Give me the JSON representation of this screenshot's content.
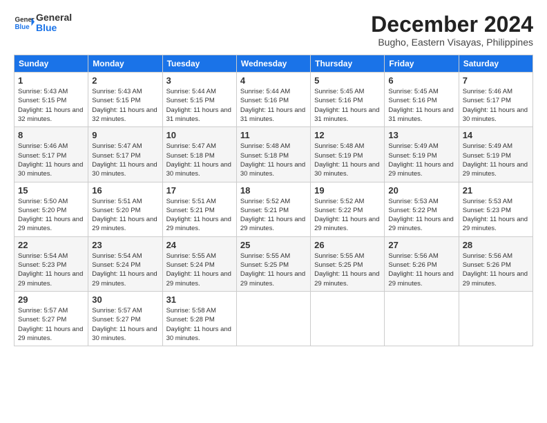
{
  "logo": {
    "line1": "General",
    "line2": "Blue"
  },
  "title": "December 2024",
  "location": "Bugho, Eastern Visayas, Philippines",
  "weekdays": [
    "Sunday",
    "Monday",
    "Tuesday",
    "Wednesday",
    "Thursday",
    "Friday",
    "Saturday"
  ],
  "weeks": [
    [
      {
        "day": "1",
        "sunrise": "5:43 AM",
        "sunset": "5:15 PM",
        "daylight": "11 hours and 32 minutes."
      },
      {
        "day": "2",
        "sunrise": "5:43 AM",
        "sunset": "5:15 PM",
        "daylight": "11 hours and 32 minutes."
      },
      {
        "day": "3",
        "sunrise": "5:44 AM",
        "sunset": "5:15 PM",
        "daylight": "11 hours and 31 minutes."
      },
      {
        "day": "4",
        "sunrise": "5:44 AM",
        "sunset": "5:16 PM",
        "daylight": "11 hours and 31 minutes."
      },
      {
        "day": "5",
        "sunrise": "5:45 AM",
        "sunset": "5:16 PM",
        "daylight": "11 hours and 31 minutes."
      },
      {
        "day": "6",
        "sunrise": "5:45 AM",
        "sunset": "5:16 PM",
        "daylight": "11 hours and 31 minutes."
      },
      {
        "day": "7",
        "sunrise": "5:46 AM",
        "sunset": "5:17 PM",
        "daylight": "11 hours and 30 minutes."
      }
    ],
    [
      {
        "day": "8",
        "sunrise": "5:46 AM",
        "sunset": "5:17 PM",
        "daylight": "11 hours and 30 minutes."
      },
      {
        "day": "9",
        "sunrise": "5:47 AM",
        "sunset": "5:17 PM",
        "daylight": "11 hours and 30 minutes."
      },
      {
        "day": "10",
        "sunrise": "5:47 AM",
        "sunset": "5:18 PM",
        "daylight": "11 hours and 30 minutes."
      },
      {
        "day": "11",
        "sunrise": "5:48 AM",
        "sunset": "5:18 PM",
        "daylight": "11 hours and 30 minutes."
      },
      {
        "day": "12",
        "sunrise": "5:48 AM",
        "sunset": "5:19 PM",
        "daylight": "11 hours and 30 minutes."
      },
      {
        "day": "13",
        "sunrise": "5:49 AM",
        "sunset": "5:19 PM",
        "daylight": "11 hours and 29 minutes."
      },
      {
        "day": "14",
        "sunrise": "5:49 AM",
        "sunset": "5:19 PM",
        "daylight": "11 hours and 29 minutes."
      }
    ],
    [
      {
        "day": "15",
        "sunrise": "5:50 AM",
        "sunset": "5:20 PM",
        "daylight": "11 hours and 29 minutes."
      },
      {
        "day": "16",
        "sunrise": "5:51 AM",
        "sunset": "5:20 PM",
        "daylight": "11 hours and 29 minutes."
      },
      {
        "day": "17",
        "sunrise": "5:51 AM",
        "sunset": "5:21 PM",
        "daylight": "11 hours and 29 minutes."
      },
      {
        "day": "18",
        "sunrise": "5:52 AM",
        "sunset": "5:21 PM",
        "daylight": "11 hours and 29 minutes."
      },
      {
        "day": "19",
        "sunrise": "5:52 AM",
        "sunset": "5:22 PM",
        "daylight": "11 hours and 29 minutes."
      },
      {
        "day": "20",
        "sunrise": "5:53 AM",
        "sunset": "5:22 PM",
        "daylight": "11 hours and 29 minutes."
      },
      {
        "day": "21",
        "sunrise": "5:53 AM",
        "sunset": "5:23 PM",
        "daylight": "11 hours and 29 minutes."
      }
    ],
    [
      {
        "day": "22",
        "sunrise": "5:54 AM",
        "sunset": "5:23 PM",
        "daylight": "11 hours and 29 minutes."
      },
      {
        "day": "23",
        "sunrise": "5:54 AM",
        "sunset": "5:24 PM",
        "daylight": "11 hours and 29 minutes."
      },
      {
        "day": "24",
        "sunrise": "5:55 AM",
        "sunset": "5:24 PM",
        "daylight": "11 hours and 29 minutes."
      },
      {
        "day": "25",
        "sunrise": "5:55 AM",
        "sunset": "5:25 PM",
        "daylight": "11 hours and 29 minutes."
      },
      {
        "day": "26",
        "sunrise": "5:55 AM",
        "sunset": "5:25 PM",
        "daylight": "11 hours and 29 minutes."
      },
      {
        "day": "27",
        "sunrise": "5:56 AM",
        "sunset": "5:26 PM",
        "daylight": "11 hours and 29 minutes."
      },
      {
        "day": "28",
        "sunrise": "5:56 AM",
        "sunset": "5:26 PM",
        "daylight": "11 hours and 29 minutes."
      }
    ],
    [
      {
        "day": "29",
        "sunrise": "5:57 AM",
        "sunset": "5:27 PM",
        "daylight": "11 hours and 29 minutes."
      },
      {
        "day": "30",
        "sunrise": "5:57 AM",
        "sunset": "5:27 PM",
        "daylight": "11 hours and 30 minutes."
      },
      {
        "day": "31",
        "sunrise": "5:58 AM",
        "sunset": "5:28 PM",
        "daylight": "11 hours and 30 minutes."
      },
      null,
      null,
      null,
      null
    ]
  ],
  "labels": {
    "sunrise": "Sunrise:",
    "sunset": "Sunset:",
    "daylight": "Daylight:"
  }
}
